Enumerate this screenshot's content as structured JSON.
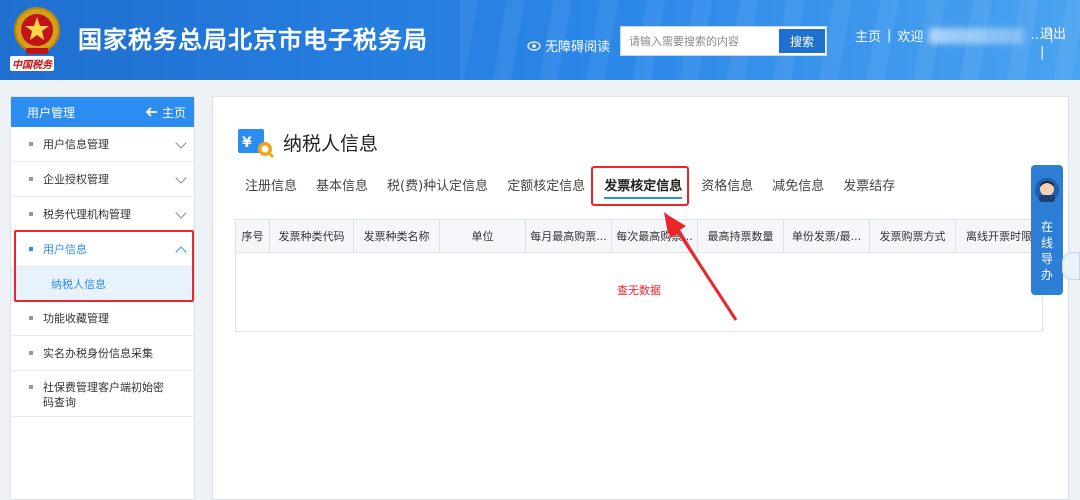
{
  "header": {
    "site_title": "国家税务总局北京市电子税务局",
    "emblem_caption": "中国税务",
    "accessibility_label": "无障碍阅读",
    "search_placeholder": "请输入需要搜索的内容",
    "search_button": "搜索",
    "home_link": "主页",
    "welcome_text": "欢迎",
    "welcome_suffix": "…",
    "logout_link": "退出"
  },
  "sidebar": {
    "title": "用户管理",
    "home_label": "主页",
    "items": [
      {
        "label": "用户信息管理"
      },
      {
        "label": "企业授权管理"
      },
      {
        "label": "税务代理机构管理"
      },
      {
        "label": "用户信息"
      },
      {
        "label": "功能收藏管理"
      },
      {
        "label": "实名办税身份信息采集"
      },
      {
        "label": "社保费管理客户端初始密码查询"
      }
    ],
    "sub_item": "纳税人信息"
  },
  "main": {
    "title": "纳税人信息",
    "tabs": [
      {
        "label": "注册信息"
      },
      {
        "label": "基本信息"
      },
      {
        "label": "税(费)种认定信息"
      },
      {
        "label": "定额核定信息"
      },
      {
        "label": "发票核定信息"
      },
      {
        "label": "资格信息"
      },
      {
        "label": "减免信息"
      },
      {
        "label": "发票结存"
      }
    ],
    "table": {
      "columns": [
        "序号",
        "发票种类代码",
        "发票种类名称",
        "单位",
        "每月最高购票...",
        "每次最高购票...",
        "最高持票数量",
        "单份发票/最...",
        "发票购票方式",
        "离线开票时限"
      ],
      "empty_message": "查无数据"
    }
  },
  "help_widget": {
    "label": "在线导办"
  },
  "colors": {
    "header_blue": "#2a86e8",
    "accent": "#2d8cf0",
    "highlight_red": "#e8262b"
  }
}
